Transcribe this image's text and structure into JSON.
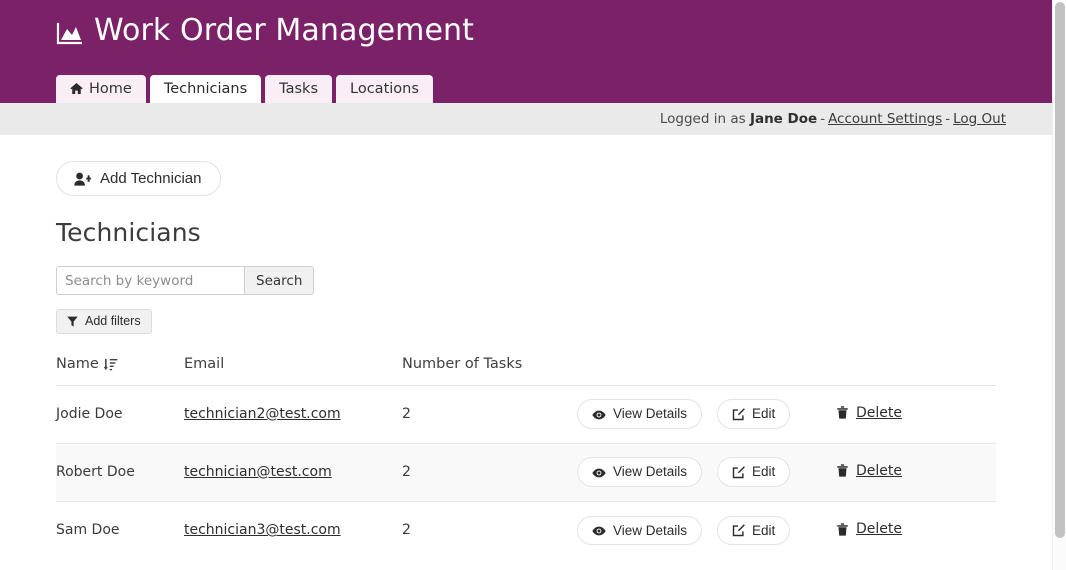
{
  "brand": {
    "title": "Work Order Management",
    "icon": "area-chart-icon"
  },
  "nav": {
    "tabs": [
      {
        "label": "Home",
        "icon": "home-icon",
        "active": false
      },
      {
        "label": "Technicians",
        "icon": "",
        "active": true
      },
      {
        "label": "Tasks",
        "icon": "",
        "active": false
      },
      {
        "label": "Locations",
        "icon": "",
        "active": false
      }
    ]
  },
  "userbar": {
    "logged_in_prefix": "Logged in as",
    "user_name": "Jane Doe",
    "separator": "-",
    "account_settings": "Account Settings",
    "log_out": "Log Out"
  },
  "toolbar": {
    "add_technician_label": "Add Technician",
    "add_technician_icon": "user-plus-icon"
  },
  "page": {
    "title": "Technicians"
  },
  "search": {
    "placeholder": "Search by keyword",
    "value": "",
    "button_label": "Search",
    "filter_label": "Add filters",
    "filter_icon": "funnel-icon"
  },
  "table": {
    "columns": [
      {
        "label": "Name",
        "sort_icon": "sort-amount-down-icon",
        "sorted": true
      },
      {
        "label": "Email",
        "sort_icon": "",
        "sorted": false
      },
      {
        "label": "Number of Tasks",
        "sort_icon": "",
        "sorted": false
      }
    ],
    "actions": {
      "view_label": "View Details",
      "view_icon": "eye-icon",
      "edit_label": "Edit",
      "edit_icon": "pencil-square-icon",
      "delete_label": "Delete",
      "delete_icon": "trash-icon"
    },
    "rows": [
      {
        "name": "Jodie Doe",
        "email": "technician2@test.com",
        "tasks": "2"
      },
      {
        "name": "Robert Doe",
        "email": "technician@test.com",
        "tasks": "2"
      },
      {
        "name": "Sam Doe",
        "email": "technician3@test.com",
        "tasks": "2"
      }
    ]
  },
  "colors": {
    "brand_purple": "#7b2167",
    "tab_inactive": "#f9eef6",
    "tab_active": "#ffffff",
    "userbar_bg": "#eaeaea",
    "row_stripe": "#f9f9f9",
    "border": "#e4e4e4"
  },
  "scrollbar": {
    "thumb_color": "#c2c2c2",
    "visible": true
  }
}
